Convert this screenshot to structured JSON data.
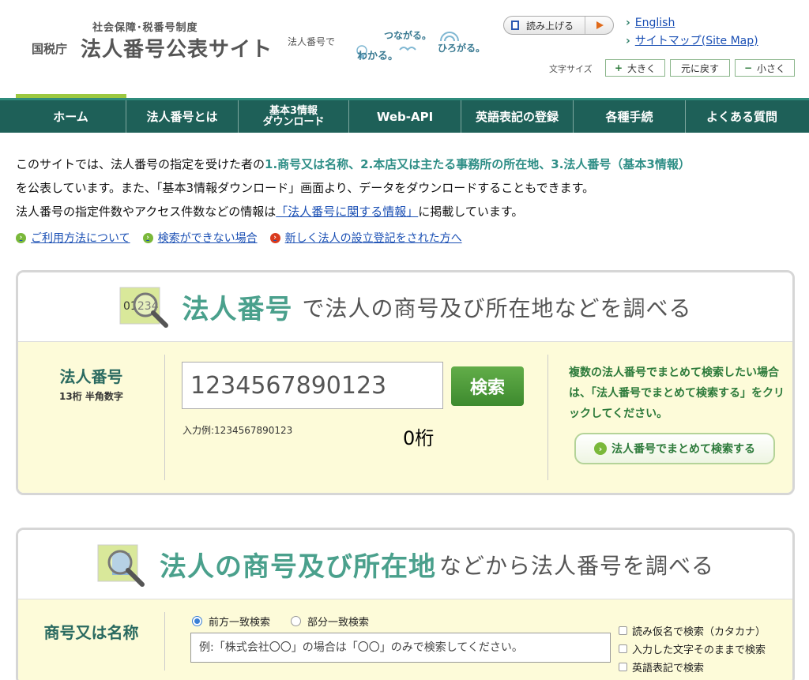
{
  "header": {
    "logo_small": "社会保障･税番号制度",
    "logo_agency": "国税庁",
    "logo_main": "法人番号公表サイト",
    "slogan_prefix": "法人番号で",
    "slogan_wakaru": "わかる。",
    "slogan_tsunagaru": "つながる。",
    "slogan_hirogaru": "ひろがる。",
    "read_aloud": "読み上げる",
    "links": [
      "English",
      "サイトマップ(Site Map)"
    ],
    "font_size_label": "文字サイズ",
    "font_larger": "大きく",
    "font_reset": "元に戻す",
    "font_smaller": "小さく"
  },
  "nav": {
    "items": [
      {
        "label": "ホーム"
      },
      {
        "label": "法人番号とは"
      },
      {
        "label_line1": "基本3情報",
        "label_line2": "ダウンロード"
      },
      {
        "label": "Web-API"
      },
      {
        "label": "英語表記の登録"
      },
      {
        "label": "各種手続"
      },
      {
        "label": "よくある質問"
      }
    ]
  },
  "intro": {
    "p1_a": "このサイトでは、法人番号の指定を受けた者の",
    "p1_hl": "1.商号又は名称、2.本店又は主たる事務所の所在地、3.法人番号（基本3情報）",
    "p1_b": "を公表しています。また、「基本3情報ダウンロード」画面より、データをダウンロードすることもできます。",
    "p2_a": "法人番号の指定件数やアクセス件数などの情報は",
    "p2_link": "「法人番号に関する情報」",
    "p2_b": "に掲載しています。",
    "sublinks": [
      "ご利用方法について",
      "検索ができない場合",
      "新しく法人の設立登記をされた方へ"
    ]
  },
  "panel1": {
    "icon_text": "01234",
    "title_big": "法人番号",
    "title_rest": "で法人の商号及び所在地などを調べる",
    "label": "法人番号",
    "sub": "13桁 半角数字",
    "input_value": "1234567890123",
    "search_button": "検索",
    "example": "入力例:1234567890123",
    "digit_count": "0桁",
    "note": "複数の法人番号でまとめて検索したい場合は、「法人番号でまとめて検索する」をクリックしてください。",
    "batch_button": "法人番号でまとめて検索する"
  },
  "panel2": {
    "title_big": "法人の商号及び所在地",
    "title_rest": "などから法人番号を調べる",
    "label": "商号又は名称",
    "radio_prefix": "前方一致検索",
    "radio_partial": "部分一致検索",
    "placeholder": "例:「株式会社〇〇」の場合は「〇〇」のみで検索してください。",
    "checks": [
      "読み仮名で検索（カタカナ）",
      "入力した文字そのままで検索",
      "英語表記で検索"
    ]
  },
  "colors": {
    "nav_bg": "#1e6058",
    "nav_active": "#9cc840",
    "accent_teal": "#4aa08c",
    "panel_body": "#fdfbd9",
    "search_green": "#3d8a2e"
  }
}
